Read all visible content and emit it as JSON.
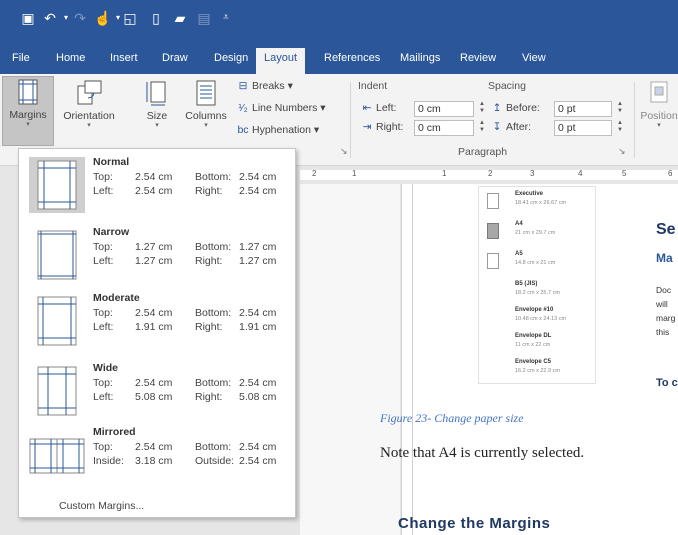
{
  "qat": {
    "icons": [
      "save-icon",
      "undo-icon",
      "redo-icon",
      "touch-mode-icon",
      "open-icon",
      "new-doc-icon",
      "folder-icon",
      "print-layout-icon",
      "customize-icon"
    ]
  },
  "tabs": [
    {
      "label": "File"
    },
    {
      "label": "Home"
    },
    {
      "label": "Insert"
    },
    {
      "label": "Draw"
    },
    {
      "label": "Design"
    },
    {
      "label": "Layout"
    },
    {
      "label": "References"
    },
    {
      "label": "Mailings"
    },
    {
      "label": "Review"
    },
    {
      "label": "View"
    }
  ],
  "ribbon": {
    "margins": "Margins",
    "orientation": "Orientation",
    "size": "Size",
    "columns": "Columns",
    "breaks": "Breaks",
    "line_numbers": "Line Numbers",
    "hyphenation": "Hyphenation",
    "indent_label": "Indent",
    "indent_left_label": "Left:",
    "indent_left_value": "0 cm",
    "indent_right_label": "Right:",
    "indent_right_value": "0 cm",
    "spacing_label": "Spacing",
    "before_label": "Before:",
    "before_value": "0 pt",
    "after_label": "After:",
    "after_value": "0 pt",
    "paragraph_group": "Paragraph",
    "position": "Position"
  },
  "ruler": {
    "numbers": [
      "2",
      "1",
      "1",
      "2",
      "3",
      "4",
      "5",
      "6"
    ]
  },
  "margins_menu": {
    "options": [
      {
        "name": "Normal",
        "r1a": "Top:",
        "r1b": "2.54 cm",
        "r1c": "Bottom:",
        "r1d": "2.54 cm",
        "r2a": "Left:",
        "r2b": "2.54 cm",
        "r2c": "Right:",
        "r2d": "2.54 cm"
      },
      {
        "name": "Narrow",
        "r1a": "Top:",
        "r1b": "1.27 cm",
        "r1c": "Bottom:",
        "r1d": "1.27 cm",
        "r2a": "Left:",
        "r2b": "1.27 cm",
        "r2c": "Right:",
        "r2d": "1.27 cm"
      },
      {
        "name": "Moderate",
        "r1a": "Top:",
        "r1b": "2.54 cm",
        "r1c": "Bottom:",
        "r1d": "2.54 cm",
        "r2a": "Left:",
        "r2b": "1.91 cm",
        "r2c": "Right:",
        "r2d": "1.91 cm"
      },
      {
        "name": "Wide",
        "r1a": "Top:",
        "r1b": "2.54 cm",
        "r1c": "Bottom:",
        "r1d": "2.54 cm",
        "r2a": "Left:",
        "r2b": "5.08 cm",
        "r2c": "Right:",
        "r2d": "5.08 cm"
      },
      {
        "name": "Mirrored",
        "r1a": "Top:",
        "r1b": "2.54 cm",
        "r1c": "Bottom:",
        "r1d": "2.54 cm",
        "r2a": "Inside:",
        "r2b": "3.18 cm",
        "r2c": "Outside:",
        "r2d": "2.54 cm"
      }
    ],
    "custom": "Custom Margins..."
  },
  "paper_sizes": [
    {
      "name": "Executive",
      "dims": "18.41 cm x 26.67 cm"
    },
    {
      "name": "A4",
      "dims": "21 cm x 29.7 cm"
    },
    {
      "name": "A5",
      "dims": "14.8 cm x 21 cm"
    },
    {
      "name": "B5 (JIS)",
      "dims": "18.2 cm x 25.7 cm"
    },
    {
      "name": "Envelope #10",
      "dims": "10.48 cm x 24.13 cm"
    },
    {
      "name": "Envelope DL",
      "dims": "11 cm x 22 cm"
    },
    {
      "name": "Envelope C5",
      "dims": "16.2 cm x 22.9 cm"
    }
  ],
  "document": {
    "caption": "Figure 23- Change paper size",
    "body": "Note that A4 is currently selected.",
    "heading": "Change the Margins",
    "right_h1": "Se",
    "right_h2": "Ma",
    "right_lines": [
      "Doc",
      "will",
      "marg",
      "this"
    ],
    "right_h3": "To c"
  }
}
